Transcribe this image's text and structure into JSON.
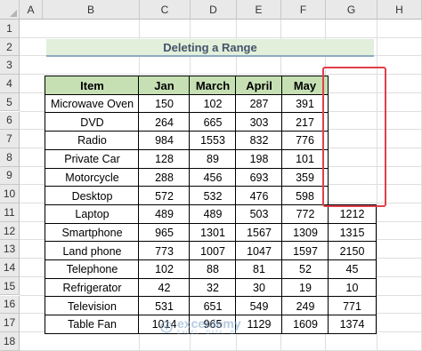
{
  "columns": [
    "A",
    "B",
    "C",
    "D",
    "E",
    "F",
    "G",
    "H"
  ],
  "rows": [
    "1",
    "2",
    "3",
    "4",
    "5",
    "6",
    "7",
    "8",
    "9",
    "10",
    "11",
    "12",
    "13",
    "14",
    "15",
    "16",
    "17",
    "18"
  ],
  "title": "Deleting a Range",
  "table": {
    "headers": [
      "Item",
      "Jan",
      "March",
      "April",
      "May"
    ],
    "rows": [
      {
        "item": "Microwave Oven",
        "jan": "150",
        "march": "102",
        "april": "287",
        "may": "391",
        "extra": ""
      },
      {
        "item": "DVD",
        "jan": "264",
        "march": "665",
        "april": "303",
        "may": "217",
        "extra": ""
      },
      {
        "item": "Radio",
        "jan": "984",
        "march": "1553",
        "april": "832",
        "may": "776",
        "extra": ""
      },
      {
        "item": "Private Car",
        "jan": "128",
        "march": "89",
        "april": "198",
        "may": "101",
        "extra": ""
      },
      {
        "item": "Motorcycle",
        "jan": "288",
        "march": "456",
        "april": "693",
        "may": "359",
        "extra": ""
      },
      {
        "item": "Desktop",
        "jan": "572",
        "march": "532",
        "april": "476",
        "may": "598",
        "extra": ""
      },
      {
        "item": "Laptop",
        "jan": "489",
        "march": "489",
        "april": "503",
        "may": "772",
        "extra": "1212"
      },
      {
        "item": "Smartphone",
        "jan": "965",
        "march": "1301",
        "april": "1567",
        "may": "1309",
        "extra": "1315"
      },
      {
        "item": "Land phone",
        "jan": "773",
        "march": "1007",
        "april": "1047",
        "may": "1597",
        "extra": "2150"
      },
      {
        "item": "Telephone",
        "jan": "102",
        "march": "88",
        "april": "81",
        "may": "52",
        "extra": "45"
      },
      {
        "item": "Refrigerator",
        "jan": "42",
        "march": "32",
        "april": "30",
        "may": "19",
        "extra": "10"
      },
      {
        "item": "Television",
        "jan": "531",
        "march": "651",
        "april": "549",
        "may": "249",
        "extra": "771"
      },
      {
        "item": "Table Fan",
        "jan": "1014",
        "march": "965",
        "april": "1129",
        "may": "1609",
        "extra": "1374"
      }
    ]
  },
  "watermark": {
    "name": "exceldemy",
    "tagline": "EXCEL · DATA · BI"
  },
  "colors": {
    "header_fill": "#c6e0b4",
    "title_fill": "#e2efda",
    "selection_border": "#e0404a"
  }
}
